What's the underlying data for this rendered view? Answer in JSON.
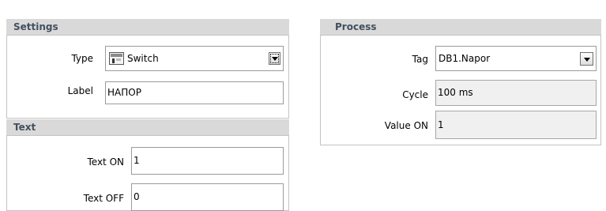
{
  "settings": {
    "title": "Settings",
    "type_label": "Type",
    "type_value": "Switch",
    "type_icon": "switch-icon",
    "label_label": "Label",
    "label_value": "НАПОР"
  },
  "text": {
    "title": "Text",
    "text_on_label": "Text ON",
    "text_on_value": "1",
    "text_off_label": "Text OFF",
    "text_off_value": "0"
  },
  "process": {
    "title": "Process",
    "tag_label": "Tag",
    "tag_value": "DB1.Napor",
    "cycle_label": "Cycle",
    "cycle_value": "100 ms",
    "value_on_label": "Value ON",
    "value_on_value": "1"
  }
}
